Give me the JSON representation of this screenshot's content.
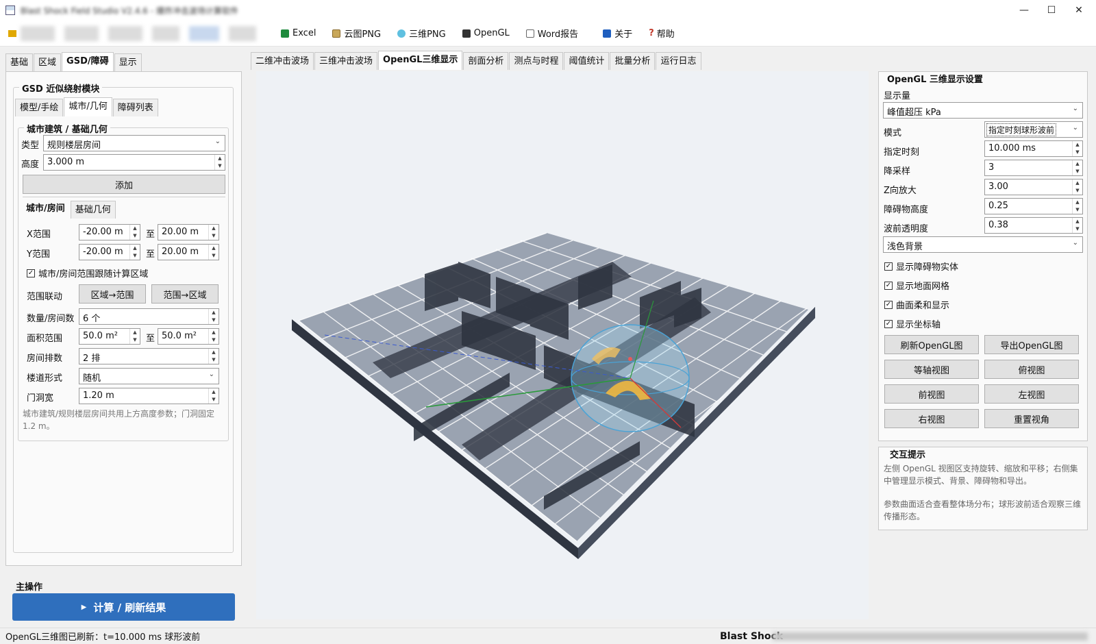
{
  "window": {
    "title": "Blast Shock Field Studio V2.4.6 - 爆炸冲击波场计算软件",
    "minimize": "—",
    "maximize": "☐",
    "close": "✕"
  },
  "toolbar": {
    "items": [
      {
        "label": "Excel",
        "icon": "excel-icon",
        "color": "#1e8a3c"
      },
      {
        "label": "云图PNG",
        "icon": "image-icon",
        "color": "#8a6a2a"
      },
      {
        "label": "三维PNG",
        "icon": "globe-icon",
        "color": "#2a8ab0"
      },
      {
        "label": "OpenGL",
        "icon": "monitor-icon",
        "color": "#333333"
      },
      {
        "label": "Word报告",
        "icon": "document-icon",
        "color": "#666666"
      },
      {
        "label": "关于",
        "icon": "info-icon",
        "color": "#1f5fbf"
      },
      {
        "label": "帮助",
        "icon": "help-icon",
        "color": "#c0392b"
      }
    ]
  },
  "left": {
    "tabs": [
      "基础",
      "区域",
      "GSD/障碍",
      "显示"
    ],
    "active_tab": 2,
    "module_title": "GSD 近似绕射模块",
    "subtabs": [
      "模型/手绘",
      "城市/几何",
      "障碍列表"
    ],
    "group_title": "城市建筑 / 基础几何",
    "type_label": "类型",
    "type_value": "规则楼层房间",
    "height_label": "高度",
    "height_value": "3.000 m",
    "add_button": "添加",
    "inner_tabs": [
      "城市/房间",
      "基础几何"
    ],
    "x_label": "X范围",
    "x_from": "-20.00 m",
    "x_to": "20.00 m",
    "y_label": "Y范围",
    "y_from": "-20.00 m",
    "y_to": "20.00 m",
    "to_text": "至",
    "follow_check": "城市/房间范围跟随计算区域",
    "link_label": "范围联动",
    "region_to_range": "区域→范围",
    "range_to_region": "范围→区域",
    "count_label": "数量/房间数",
    "count_value": "6 个",
    "area_label": "面积范围",
    "area_from": "50.0 m²",
    "area_to": "50.0 m²",
    "rows_label": "房间排数",
    "rows_value": "2 排",
    "corridor_label": "楼道形式",
    "corridor_value": "随机",
    "door_label": "门洞宽",
    "door_value": "1.20 m",
    "note": "城市建筑/规则楼层房间共用上方高度参数；门洞固定1.2 m。"
  },
  "main_op": {
    "title": "主操作",
    "run_button": "计算 / 刷新结果"
  },
  "center": {
    "tabs": [
      "二维冲击波场",
      "三维冲击波场",
      "OpenGL三维显示",
      "剖面分析",
      "测点与时程",
      "阈值统计",
      "批量分析",
      "运行日志"
    ],
    "active_tab": 2
  },
  "right": {
    "title": "OpenGL 三维显示设置",
    "quantity_label": "显示量",
    "quantity_value": "峰值超压 kPa",
    "mode_label": "模式",
    "mode_value": "指定时刻球形波前",
    "time_label": "指定时刻",
    "time_value": "10.000 ms",
    "downsample_label": "降采样",
    "downsample_value": "3",
    "zscale_label": "Z向放大",
    "zscale_value": "3.00",
    "obst_height_label": "障碍物高度",
    "obst_height_value": "0.25",
    "front_alpha_label": "波前透明度",
    "front_alpha_value": "0.38",
    "background_value": "浅色背景",
    "checks": [
      "显示障碍物实体",
      "显示地面网格",
      "曲面柔和显示",
      "显示坐标轴"
    ],
    "buttons": [
      "刷新OpenGL图",
      "导出OpenGL图",
      "等轴视图",
      "俯视图",
      "前视图",
      "左视图",
      "右视图",
      "重置视角"
    ]
  },
  "hint": {
    "title": "交互提示",
    "p1": "左侧 OpenGL 视图区支持旋转、缩放和平移；右侧集中管理显示模式、背景、障碍物和导出。",
    "p2": "参数曲面适合查看整体场分布；球形波前适合观察三维传播形态。"
  },
  "status": {
    "message": "OpenGL三维图已刷新：t=10.000 ms 球形波前",
    "brand": "Blast Shock"
  }
}
